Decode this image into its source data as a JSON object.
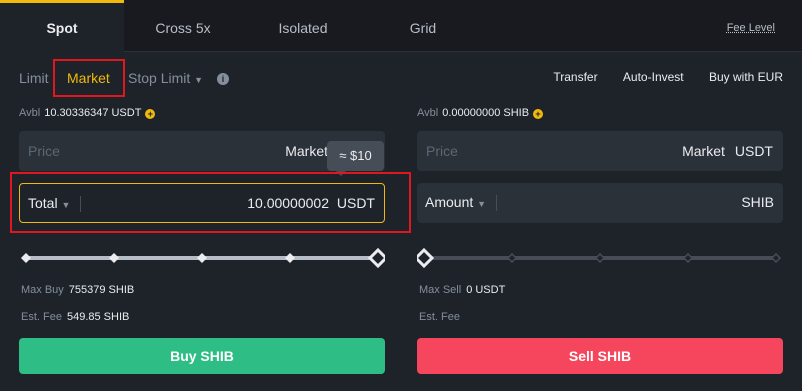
{
  "tabs": [
    "Spot",
    "Cross 5x",
    "Isolated",
    "Grid"
  ],
  "fee_level": "Fee Level",
  "order_types": {
    "limit": "Limit",
    "market": "Market",
    "stop_limit": "Stop Limit"
  },
  "links": {
    "transfer": "Transfer",
    "auto_invest": "Auto-Invest",
    "buy_eur": "Buy with EUR"
  },
  "buy": {
    "avbl_label": "Avbl",
    "avbl_value": "10.30336347 USDT",
    "price_placeholder": "Price",
    "price_value": "Market",
    "tooltip": "≈ $10",
    "total_label": "Total",
    "total_value": "10.00000002",
    "total_unit": "USDT",
    "slider_fraction": 1.0,
    "max_label": "Max Buy",
    "max_value": "755379 SHIB",
    "fee_label": "Est. Fee",
    "fee_value": "549.85 SHIB",
    "button": "Buy SHIB"
  },
  "sell": {
    "avbl_label": "Avbl",
    "avbl_value": "0.00000000 SHIB",
    "price_placeholder": "Price",
    "price_value": "Market",
    "price_unit": "USDT",
    "amount_label": "Amount",
    "amount_unit": "SHIB",
    "slider_fraction": 0.0,
    "max_label": "Max Sell",
    "max_value": "0 USDT",
    "fee_label": "Est. Fee",
    "button": "Sell SHIB"
  },
  "colors": {
    "accent": "#f0b90b",
    "buy": "#2ebd85",
    "sell": "#f6465d",
    "highlight": "#e0171f"
  }
}
